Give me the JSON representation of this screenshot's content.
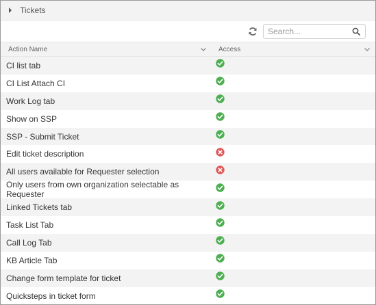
{
  "section": {
    "title": "Tickets",
    "icon": "caret-right-icon"
  },
  "toolbar": {
    "refresh_icon": "refresh-icon",
    "search_placeholder": "Search...",
    "search_value": "",
    "search_icon": "search-icon"
  },
  "columns": {
    "action_name": "Action Name",
    "access": "Access"
  },
  "colors": {
    "allowed": "#4caf50",
    "denied": "#e05a5a",
    "accent": "#5a8fc8"
  },
  "rows": [
    {
      "action": "CI list tab",
      "access": "allowed"
    },
    {
      "action": "CI List Attach CI",
      "access": "allowed"
    },
    {
      "action": "Work Log tab",
      "access": "allowed"
    },
    {
      "action": "Show on SSP",
      "access": "allowed"
    },
    {
      "action": "SSP - Submit Ticket",
      "access": "allowed"
    },
    {
      "action": "Edit ticket description",
      "access": "denied"
    },
    {
      "action": "All users available for Requester selection",
      "access": "denied"
    },
    {
      "action": "Only users from own organization selectable as Requester",
      "access": "allowed"
    },
    {
      "action": "Linked Tickets tab",
      "access": "allowed"
    },
    {
      "action": "Task List Tab",
      "access": "allowed"
    },
    {
      "action": "Call Log Tab",
      "access": "allowed"
    },
    {
      "action": "KB Article Tab",
      "access": "allowed"
    },
    {
      "action": "Change form template for ticket",
      "access": "allowed"
    },
    {
      "action": "Quicksteps in ticket form",
      "access": "allowed"
    }
  ]
}
